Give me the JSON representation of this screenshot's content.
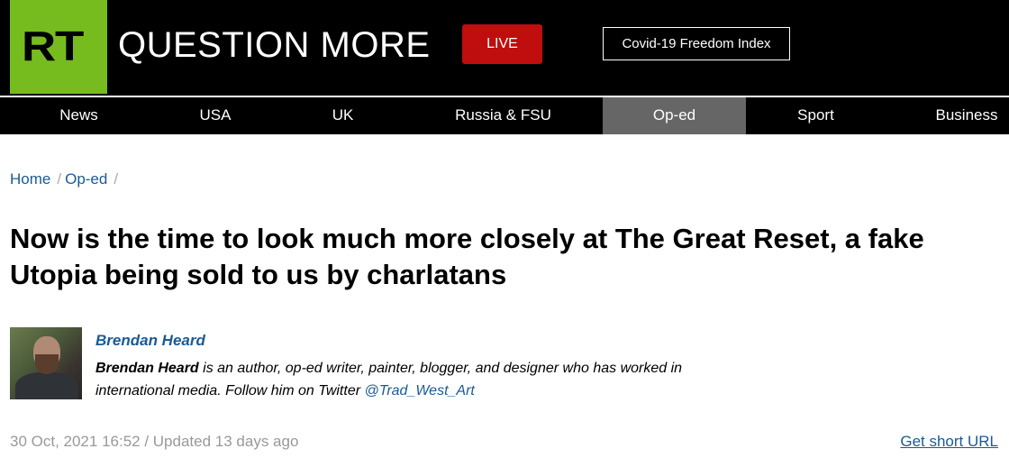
{
  "header": {
    "logo": "RT",
    "tagline": "QUESTION MORE",
    "live_label": "LIVE",
    "index_label": "Covid-19 Freedom Index"
  },
  "nav": {
    "items": [
      {
        "label": "News"
      },
      {
        "label": "USA"
      },
      {
        "label": "UK"
      },
      {
        "label": "Russia & FSU"
      },
      {
        "label": "Op-ed",
        "active": true
      },
      {
        "label": "Sport"
      },
      {
        "label": "Business"
      }
    ]
  },
  "breadcrumb": {
    "home": "Home",
    "section": "Op-ed",
    "separator": "/"
  },
  "article": {
    "title": "Now is the time to look much more closely at The Great Reset, a fake Utopia being sold to us by charlatans",
    "author": {
      "name": "Brendan Heard",
      "bio_name": "Brendan Heard",
      "bio_text": " is an author, op-ed writer, painter, blogger, and designer who has worked in international media. Follow him on Twitter ",
      "twitter": "@Trad_West_Art"
    },
    "date": "30 Oct, 2021 16:52 / Updated 13 days ago",
    "short_url_label": "Get short URL"
  },
  "colors": {
    "brand_green": "#77bc1f",
    "live_red": "#c00d0d",
    "link_blue": "#1a5a96",
    "nav_active": "#666666"
  }
}
